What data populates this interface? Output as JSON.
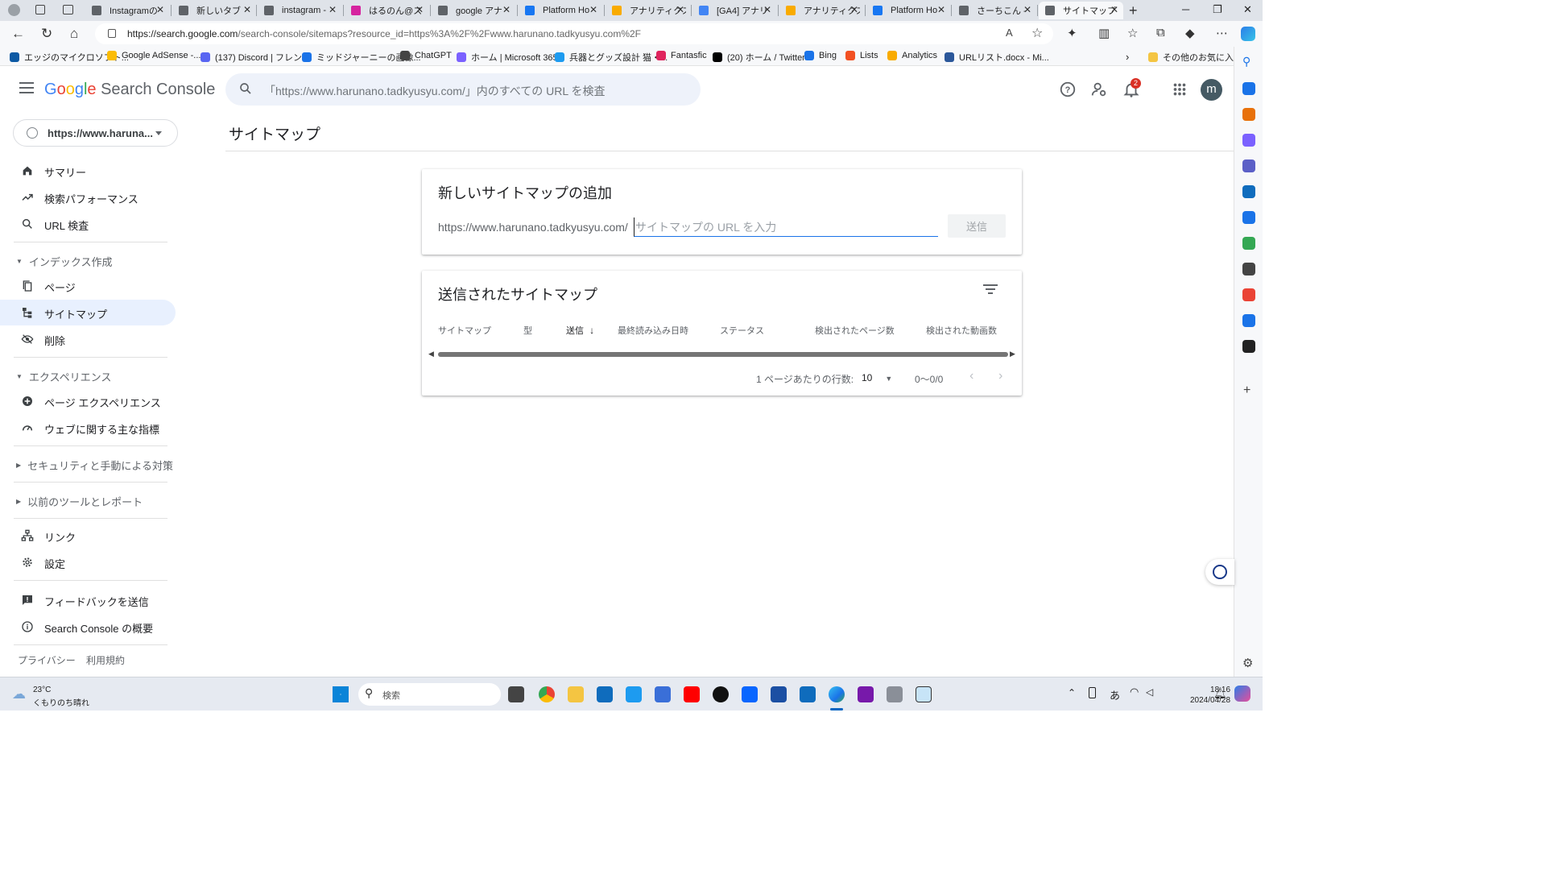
{
  "browser": {
    "tabs": [
      {
        "label": "Instagramの",
        "color": "#5f6368",
        "icon": "search-icon"
      },
      {
        "label": "新しいタブ",
        "color": "#5f6368",
        "icon": "page-icon"
      },
      {
        "label": "instagram -",
        "color": "#5f6368",
        "icon": "search-icon"
      },
      {
        "label": "はるのん@ス",
        "color": "#d6249f",
        "icon": "instagram-icon"
      },
      {
        "label": "google アナ",
        "color": "#5f6368",
        "icon": "search-icon"
      },
      {
        "label": "Platform Ho",
        "color": "#1877f2",
        "icon": "meta-icon"
      },
      {
        "label": "アナリティクス",
        "color": "#f9ab00",
        "icon": "analytics-icon"
      },
      {
        "label": "[GA4] アナリ",
        "color": "#4285f4",
        "icon": "google-icon"
      },
      {
        "label": "アナリティクス",
        "color": "#f9ab00",
        "icon": "analytics-icon"
      },
      {
        "label": "Platform Ho",
        "color": "#1877f2",
        "icon": "meta-icon"
      },
      {
        "label": "さーちこん -",
        "color": "#5f6368",
        "icon": "search-icon"
      },
      {
        "label": "サイトマップ",
        "color": "#5f6368",
        "icon": "gsc-icon"
      }
    ],
    "url_host": "https://search.google.com",
    "url_path": "/search-console/sitemaps?resource_id=https%3A%2F%2Fwww.harunano.tadkyusyu.com%2F",
    "favorites": [
      {
        "label": "エッジのマイクロソフト...",
        "color": "#0c59a4"
      },
      {
        "label": "Google AdSense -...",
        "color": "#fbbc05"
      },
      {
        "label": "(137) Discord | フレンド",
        "color": "#5865f2"
      },
      {
        "label": "ミッドジャーニーの画像...",
        "color": "#1a73e8"
      },
      {
        "label": "ChatGPT",
        "color": "#444444"
      },
      {
        "label": "ホーム | Microsoft 365",
        "color": "#7b61ff"
      },
      {
        "label": "兵器とグッズ設計 猫・...",
        "color": "#1d9bf0"
      },
      {
        "label": "Fantasfic",
        "color": "#e0245e"
      },
      {
        "label": "(20) ホーム / Twitter",
        "color": "#000000"
      },
      {
        "label": "Bing",
        "color": "#1a73e8"
      },
      {
        "label": "Lists",
        "color": "#f25022"
      },
      {
        "label": "Analytics",
        "color": "#f9ab00"
      },
      {
        "label": "URLリスト.docx - Mi...",
        "color": "#2b579a"
      },
      {
        "label": "その他のお気に入り",
        "color": "#f4c542"
      }
    ]
  },
  "header": {
    "logo_google": [
      "G",
      "o",
      "o",
      "g",
      "l",
      "e"
    ],
    "logo_product": "Search Console",
    "search_placeholder": "「https://www.harunano.tadkyusyu.com/」内のすべての URL を検査",
    "notification_count": "2",
    "avatar_letter": "m"
  },
  "property": {
    "label": "https://www.haruna..."
  },
  "sidebar": {
    "items": [
      {
        "label": "サマリー",
        "icon": "home-icon"
      },
      {
        "label": "検索パフォーマンス",
        "icon": "trending-icon"
      },
      {
        "label": "URL 検査",
        "icon": "search-icon"
      }
    ],
    "index_section": "インデックス作成",
    "index_items": [
      {
        "label": "ページ",
        "icon": "pages-icon"
      },
      {
        "label": "サイトマップ",
        "icon": "sitemap-icon"
      },
      {
        "label": "削除",
        "icon": "removal-icon"
      }
    ],
    "experience_section": "エクスペリエンス",
    "experience_items": [
      {
        "label": "ページ エクスペリエンス",
        "icon": "page-experience-icon"
      },
      {
        "label": "ウェブに関する主な指標",
        "icon": "speed-icon"
      }
    ],
    "security_section": "セキュリティと手動による対策",
    "legacy_section": "以前のツールとレポート",
    "bottom_items": [
      {
        "label": "リンク",
        "icon": "links-icon"
      },
      {
        "label": "設定",
        "icon": "settings-icon"
      }
    ],
    "help_items": [
      {
        "label": "フィードバックを送信",
        "icon": "feedback-icon"
      },
      {
        "label": "Search Console の概要",
        "icon": "info-icon"
      }
    ],
    "footer": {
      "privacy": "プライバシー",
      "terms": "利用規約"
    }
  },
  "main": {
    "title": "サイトマップ",
    "add_card": {
      "title": "新しいサイトマップの追加",
      "prefix": "https://www.harunano.tadkyusyu.com/",
      "placeholder": "サイトマップの URL を入力",
      "submit": "送信"
    },
    "submitted_card": {
      "title": "送信されたサイトマップ",
      "columns": [
        "サイトマップ",
        "型",
        "送信",
        "最終読み込み日時",
        "ステータス",
        "検出されたページ数",
        "検出された動画数"
      ],
      "rows_per_page_label": "1 ページあたりの行数:",
      "rows_per_page": "10",
      "range": "0～0/0"
    }
  },
  "taskbar": {
    "temp": "23°C",
    "weather": "くもりのち晴れ",
    "search_label": "検索",
    "time": "18:16",
    "date": "2024/04/28",
    "ime": "あ"
  }
}
